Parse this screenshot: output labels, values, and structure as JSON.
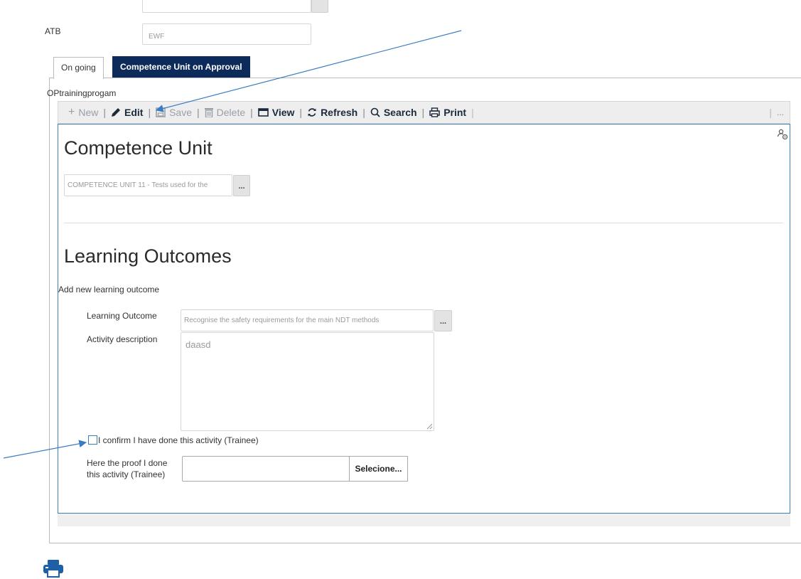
{
  "top": {
    "atb_label": "ATB",
    "atb_value": "EWF"
  },
  "tabs": [
    {
      "label": "On going"
    },
    {
      "label": "Competence Unit on Approval"
    }
  ],
  "section_label": "OPtrainingprogam",
  "toolbar": {
    "new": "New",
    "edit": "Edit",
    "save": "Save",
    "delete": "Delete",
    "view": "View",
    "refresh": "Refresh",
    "search": "Search",
    "print": "Print",
    "more": "..."
  },
  "form": {
    "competence_unit_title": "Competence Unit",
    "competence_unit_value": "COMPETENCE UNIT 11 - Tests used for the",
    "lookup_button": "...",
    "learning_outcomes_title": "Learning Outcomes",
    "add_new_label": "Add new learning outcome",
    "learning_outcome_label": "Learning Outcome",
    "learning_outcome_value": "Recognise the safety requirements for the main NDT methods",
    "activity_description_label": "Activity description",
    "activity_description_value": "daasd",
    "confirm_label": "I confirm I have done this activity (Trainee)",
    "confirm_checked": false,
    "proof_label_line1": "Here the proof I done",
    "proof_label_line2": "this activity (Trainee)",
    "proof_value": "",
    "select_button": "Selecione..."
  },
  "colors": {
    "accent": "#0d2b5a",
    "panel_border": "#3d7fc1",
    "arrow": "#3a7cc4",
    "print_icon": "#1f5fa8"
  }
}
